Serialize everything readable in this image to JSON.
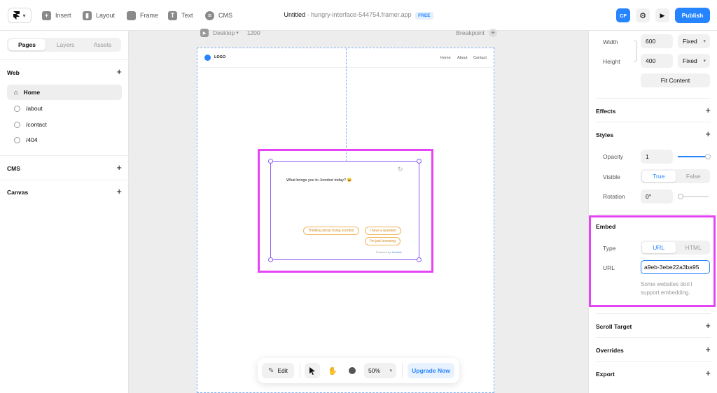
{
  "toolbar": {
    "menu_label": "▾",
    "items": [
      {
        "label": "Insert",
        "icon": "plus-icon"
      },
      {
        "label": "Layout",
        "icon": "layout-icon"
      },
      {
        "label": "Frame",
        "icon": "frame-icon"
      },
      {
        "label": "Text",
        "icon": "text-icon"
      },
      {
        "label": "CMS",
        "icon": "database-icon"
      }
    ],
    "doc_title": "Untitled",
    "doc_url": "hungry-interface-544754.framer.app",
    "badge": "FREE",
    "avatar": "CF",
    "publish": "Publish"
  },
  "left": {
    "tabs": [
      "Pages",
      "Layers",
      "Assets"
    ],
    "web_label": "Web",
    "pages": [
      "Home",
      "/about",
      "/contact",
      "/404"
    ],
    "cms_label": "CMS",
    "canvas_label": "Canvas"
  },
  "canvas": {
    "breakpoint_name": "Desktop",
    "breakpoint_width": "1200",
    "breakpoint_label": "Breakpoint",
    "logo": "LOGO",
    "nav": [
      "Home",
      "About",
      "Contact"
    ],
    "chat_question": "What brings you to Joonbot today? 😀",
    "chat_options": [
      "Thinking about trying Joonbot",
      "I have a question",
      "I'm just browsing"
    ],
    "powered_by": "Powered by",
    "powered_brand": "Joonbot"
  },
  "right": {
    "width_label": "Width",
    "width_value": "600",
    "width_mode": "Fixed",
    "height_label": "Height",
    "height_value": "400",
    "height_mode": "Fixed",
    "fit_content": "Fit Content",
    "effects": "Effects",
    "styles": "Styles",
    "opacity_label": "Opacity",
    "opacity_value": "1",
    "visible_label": "Visible",
    "visible_true": "True",
    "visible_false": "False",
    "rotation_label": "Rotation",
    "rotation_value": "0°",
    "embed": "Embed",
    "type_label": "Type",
    "type_url": "URL",
    "type_html": "HTML",
    "url_label": "URL",
    "url_value": "a9eb-3ebe22a3ba95",
    "embed_note": "Some websites don't support embedding.",
    "scroll_target": "Scroll Target",
    "overrides": "Overrides",
    "export": "Export"
  },
  "bottom": {
    "edit": "Edit",
    "zoom": "50%",
    "upgrade": "Upgrade Now"
  },
  "colors": {
    "accent": "#2684ff",
    "highlight": "#e645f5",
    "selection": "#8b5cf6"
  }
}
